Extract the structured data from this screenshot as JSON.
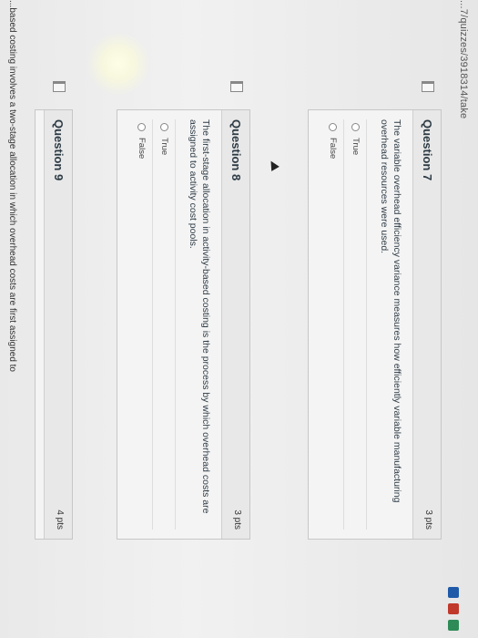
{
  "url_text": "...7/quizzes/3918314/take",
  "questions": [
    {
      "title": "Question 7",
      "points": "3 pts",
      "text": "The variable overhead efficiency variance measures how efficiently variable manufacturing overhead resources were used.",
      "answers": [
        "True",
        "False"
      ]
    },
    {
      "title": "Question 8",
      "points": "3 pts",
      "text": "The first-stage allocation in activity-based costing is the process by which overhead costs are assigned to activity cost pools.",
      "answers": [
        "True",
        "False"
      ]
    },
    {
      "title": "Question 9",
      "points": "4 pts",
      "text": "...based costing involves a two-stage allocation in which overhead costs are first assigned to"
    }
  ],
  "colors": {
    "accent_green": "#2e8b57",
    "taskbar_blue": "#1e5aa8",
    "taskbar_red": "#c0392b"
  }
}
